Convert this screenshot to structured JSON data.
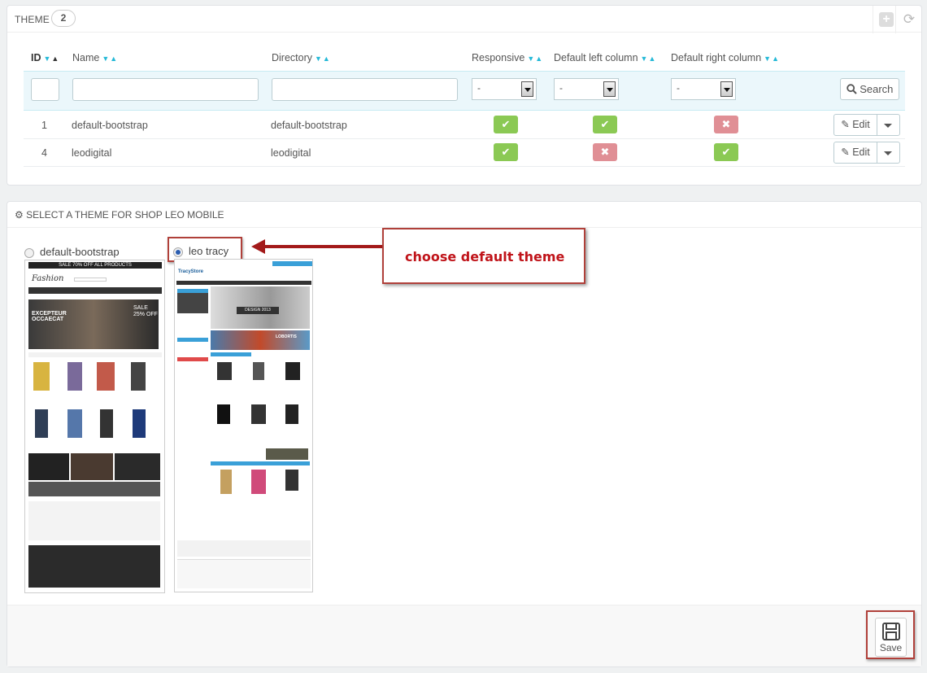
{
  "theme_panel": {
    "title": "Theme",
    "count": "2",
    "columns": {
      "id": "ID",
      "name": "Name",
      "directory": "Directory",
      "responsive": "Responsive",
      "left": "Default left column",
      "right": "Default right column"
    },
    "filters": {
      "responsive": "-",
      "left": "-",
      "right": "-",
      "search_label": "Search"
    },
    "rows": [
      {
        "id": "1",
        "name": "default-bootstrap",
        "directory": "default-bootstrap",
        "responsive": true,
        "left": true,
        "right": false,
        "edit": "Edit"
      },
      {
        "id": "4",
        "name": "leodigital",
        "directory": "leodigital",
        "responsive": true,
        "left": false,
        "right": true,
        "edit": "Edit"
      }
    ]
  },
  "select_panel": {
    "title": "Select a theme for shop Leo Mobile",
    "options": [
      {
        "label": "default-bootstrap",
        "selected": false
      },
      {
        "label": "leo tracy",
        "selected": true
      }
    ],
    "annotation": "choose default theme",
    "save_label": "Save"
  },
  "thumbs": {
    "a_banner": "SALE 70% OFF ALL PRODUCTS",
    "a_logo": "Fashion",
    "a_hero": "EXCEPTEUR OCCAECAT",
    "a_sale": "SALE 25% OFF",
    "b_logo": "TracyStore",
    "b_hero": "DESIGN 2013",
    "b_promo": "LOBORTIS"
  },
  "colors": {
    "accent": "#25b9d7",
    "success": "#8bc954",
    "danger": "#e08f95",
    "annotation_red": "#c0141a"
  }
}
